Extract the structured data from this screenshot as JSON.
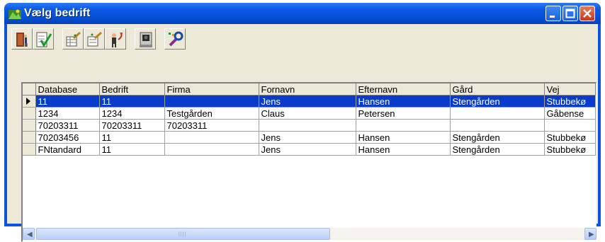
{
  "window": {
    "title": "Vælg bedrift"
  },
  "grid": {
    "columns": [
      "Database",
      "Bedrift",
      "Firma",
      "Fornavn",
      "Efternavn",
      "Gård",
      "Vej"
    ],
    "rows": [
      [
        "11",
        "11",
        "",
        "Jens",
        "Hansen",
        "Stengården",
        "Stubbekø"
      ],
      [
        "1234",
        "1234",
        "Testgården",
        "Claus",
        "Petersen",
        "",
        "Gåbense"
      ],
      [
        "70203311",
        "70203311",
        "70203311",
        "",
        "",
        "",
        ""
      ],
      [
        "70203456",
        "11",
        "",
        "Jens",
        "Hansen",
        "Stengården",
        "Stubbekø"
      ],
      [
        "FNtandard",
        "11",
        "",
        "Jens",
        "Hansen",
        "Stengården",
        "Stubbekø"
      ]
    ],
    "selected_row": 0
  },
  "colors": {
    "title_bar": "#0a55e0",
    "selection": "#0a3ccc",
    "face": "#ece9d8"
  }
}
